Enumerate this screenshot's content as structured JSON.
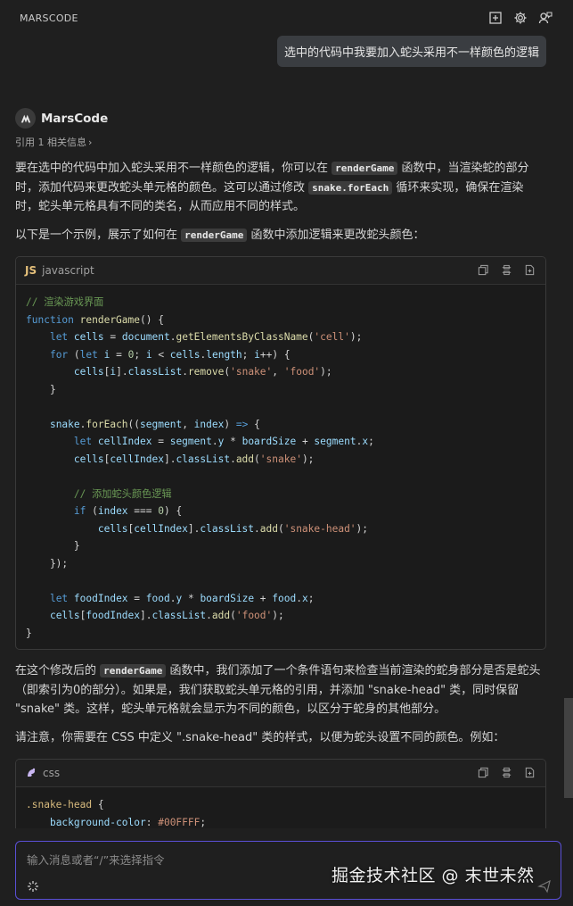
{
  "header": {
    "title": "MARSCODE",
    "icons": [
      "new-chat-icon",
      "gear-icon",
      "feedback-icon"
    ]
  },
  "user_message": "选中的代码中我要加入蛇头采用不一样颜色的逻辑",
  "assistant": {
    "name": "MarsCode",
    "reference": "引用 1 相关信息",
    "p1": {
      "a": "要在选中的代码中加入蛇头采用不一样颜色的逻辑，你可以在 ",
      "code1": "renderGame",
      "b": " 函数中，当渲染蛇的部分时，添加代码来更改蛇头单元格的颜色。这可以通过修改 ",
      "code2": "snake.forEach",
      "c": " 循环来实现，确保在渲染时，蛇头单元格具有不同的类名，从而应用不同的样式。"
    },
    "p2": {
      "a": "以下是一个示例，展示了如何在 ",
      "code1": "renderGame",
      "b": " 函数中添加逻辑来更改蛇头颜色："
    },
    "code_block_1": {
      "badge": "JS",
      "lang": "javascript"
    },
    "p3": {
      "a": "在这个修改后的 ",
      "code1": "renderGame",
      "b": " 函数中，我们添加了一个条件语句来检查当前渲染的蛇身部分是否是蛇头（即索引为0的部分）。如果是，我们获取蛇头单元格的引用，并添加 \"snake-head\" 类，同时保留 \"snake\" 类。这样，蛇头单元格就会显示为不同的颜色，以区分于蛇身的其他部分。"
    },
    "p4": "请注意，你需要在 CSS 中定义 \".snake-head\" 类的样式，以便为蛇头设置不同的颜色。例如：",
    "code_block_2": {
      "lang": "css"
    }
  },
  "input": {
    "placeholder": "输入消息或者“/”来选择指令"
  },
  "watermark": "掘金技术社区 @ 末世未然",
  "colors": {
    "background": "#1f1f1f",
    "accent": "#5a4fd6",
    "bubble": "#3a3d41"
  }
}
